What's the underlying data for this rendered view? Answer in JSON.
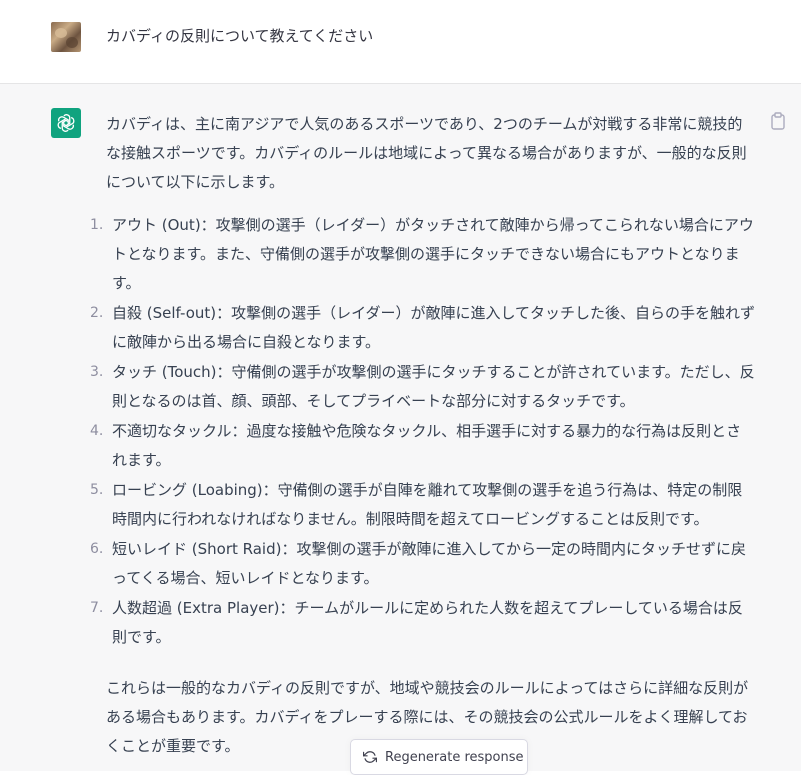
{
  "user_message": "カバディの反則について教えてください",
  "assistant": {
    "intro": "カバディは、主に南アジアで人気のあるスポーツであり、2つのチームが対戦する非常に競技的な接触スポーツです。カバディのルールは地域によって異なる場合がありますが、一般的な反則について以下に示します。",
    "items": [
      {
        "num": "1.",
        "text": "アウト (Out)：攻撃側の選手（レイダー）がタッチされて敵陣から帰ってこられない場合にアウトとなります。また、守備側の選手が攻撃側の選手にタッチできない場合にもアウトとなります。"
      },
      {
        "num": "2.",
        "text": "自殺 (Self-out)：攻撃側の選手（レイダー）が敵陣に進入してタッチした後、自らの手を触れずに敵陣から出る場合に自殺となります。"
      },
      {
        "num": "3.",
        "text": "タッチ (Touch)：守備側の選手が攻撃側の選手にタッチすることが許されています。ただし、反則となるのは首、顔、頭部、そしてプライベートな部分に対するタッチです。"
      },
      {
        "num": "4.",
        "text": "不適切なタックル：過度な接触や危険なタックル、相手選手に対する暴力的な行為は反則とされます。"
      },
      {
        "num": "5.",
        "text": "ロービング (Loabing)：守備側の選手が自陣を離れて攻撃側の選手を追う行為は、特定の制限時間内に行われなければなりません。制限時間を超えてロービングすることは反則です。"
      },
      {
        "num": "6.",
        "text": "短いレイド (Short Raid)：攻撃側の選手が敵陣に進入してから一定の時間内にタッチせずに戻ってくる場合、短いレイドとなります。"
      },
      {
        "num": "7.",
        "text": "人数超過 (Extra Player)：チームがルールに定められた人数を超えてプレーしている場合は反則です。"
      }
    ],
    "outro": "これらは一般的なカバディの反則ですが、地域や競技会のルールによってはさらに詳細な反則がある場合もあります。カバディをプレーする際には、その競技会の公式ルールをよく理解しておくことが重要です。"
  },
  "regenerate_label": "Regenerate response",
  "icons": {
    "user_avatar": "user-photo-avatar",
    "assistant_avatar": "openai-logo-icon",
    "copy": "clipboard-icon",
    "regenerate": "refresh-icon"
  },
  "colors": {
    "assistant_bg": "#f7f7f8",
    "bot_avatar": "#10a37f",
    "text": "#374151"
  }
}
